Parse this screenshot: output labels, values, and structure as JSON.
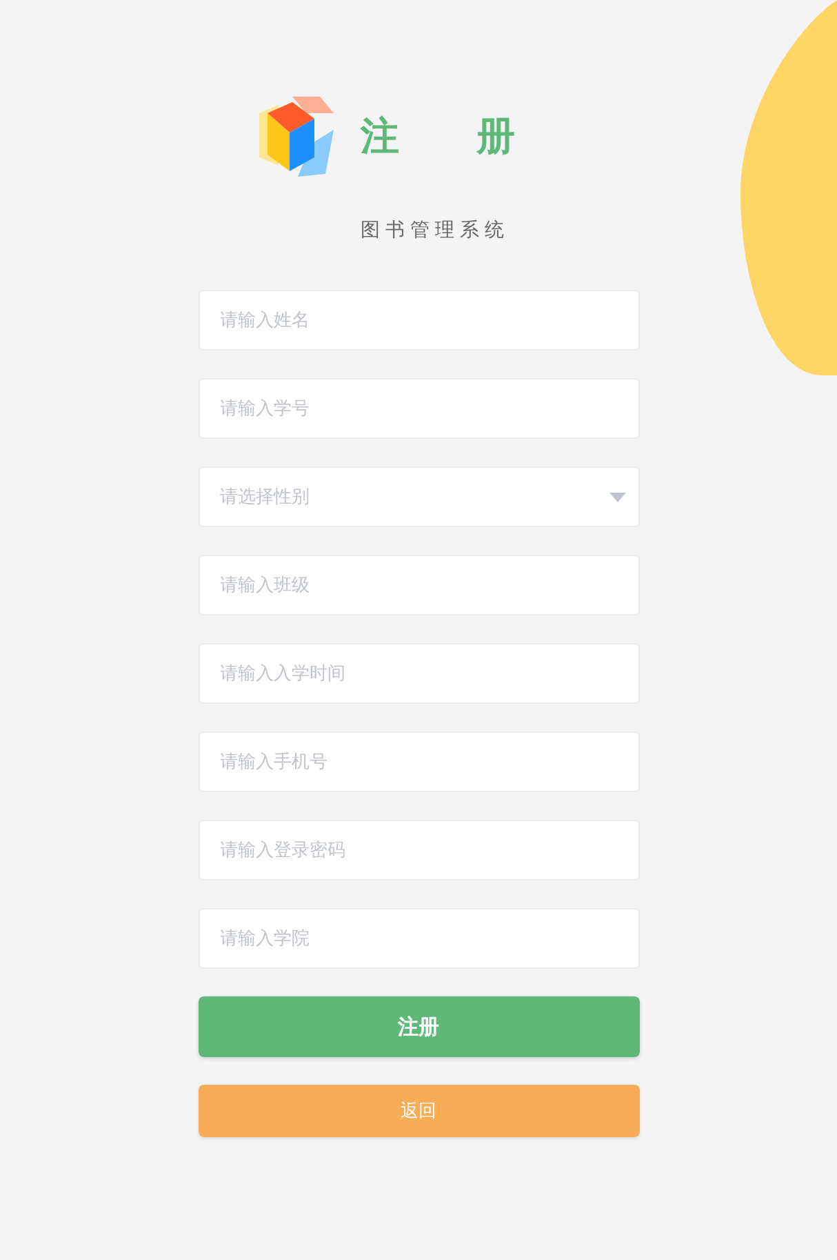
{
  "header": {
    "title": "注　　册",
    "subtitle": "图书管理系统"
  },
  "fields": [
    {
      "kind": "input",
      "placeholder": "请输入姓名"
    },
    {
      "kind": "input",
      "placeholder": "请输入学号"
    },
    {
      "kind": "select",
      "placeholder": "请选择性别"
    },
    {
      "kind": "input",
      "placeholder": "请输入班级"
    },
    {
      "kind": "input",
      "placeholder": "请输入入学时间"
    },
    {
      "kind": "input",
      "placeholder": "请输入手机号"
    },
    {
      "kind": "input",
      "placeholder": "请输入登录密码"
    },
    {
      "kind": "input",
      "placeholder": "请输入学院"
    }
  ],
  "buttons": [
    {
      "kind": "primary",
      "label": "注册"
    },
    {
      "kind": "secondary",
      "label": "返回"
    }
  ]
}
